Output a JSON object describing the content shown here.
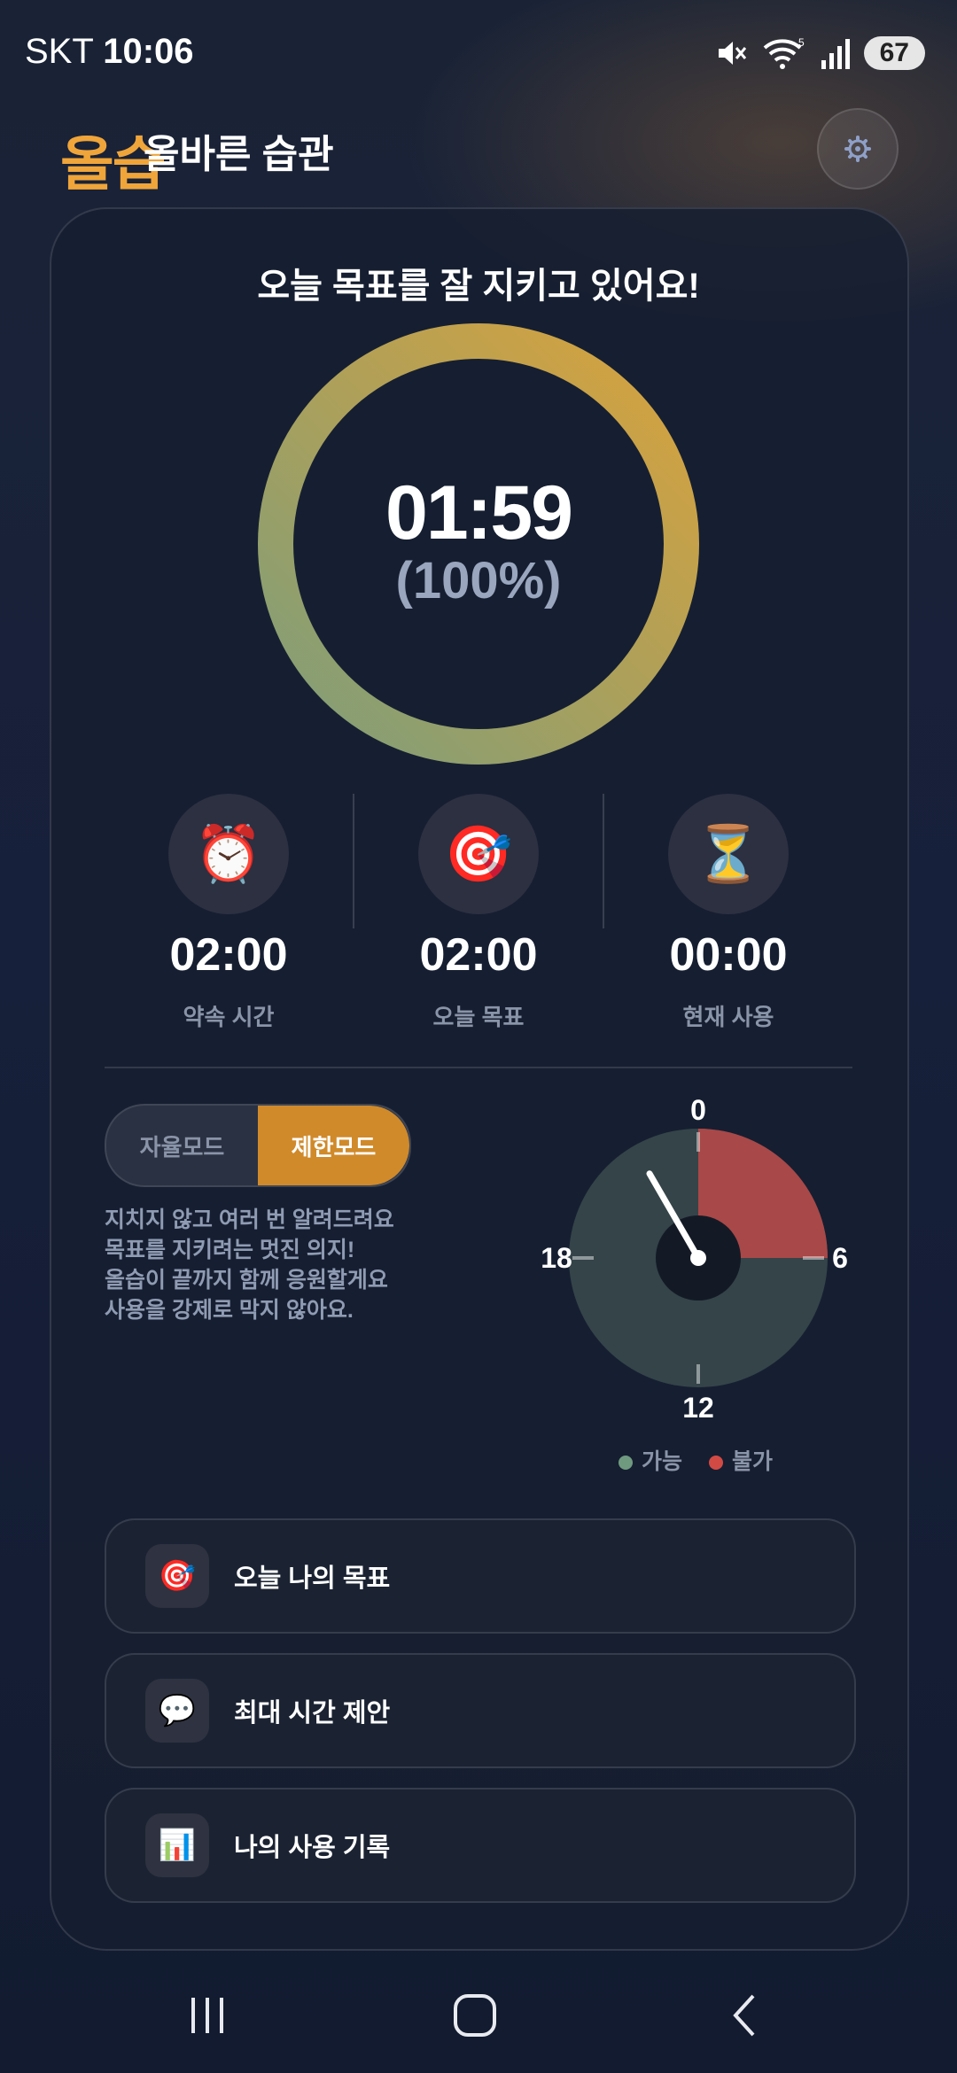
{
  "status_bar": {
    "carrier": "SKT",
    "time": "10:06",
    "battery": "67"
  },
  "header": {
    "logo": "올습",
    "title": "올바른 습관",
    "settings_icon": "gear-icon"
  },
  "main": {
    "headline": "오늘 목표를 잘 지키고 있어요!",
    "ring": {
      "time": "01:59",
      "percent_text": "(100%)",
      "progress": 1.0,
      "colors": [
        "#7e9e7a",
        "#d9a23c"
      ]
    },
    "stats": [
      {
        "icon": "alarm-clock-icon",
        "emoji": "⏰",
        "value": "02:00",
        "label": "약속 시간"
      },
      {
        "icon": "target-icon",
        "emoji": "🎯",
        "value": "02:00",
        "label": "오늘 목표"
      },
      {
        "icon": "hourglass-icon",
        "emoji": "⏳",
        "value": "00:00",
        "label": "현재 사용"
      }
    ],
    "mode": {
      "options": [
        "자율모드",
        "제한모드"
      ],
      "selected": "제한모드",
      "accent": "#d08a2a",
      "description": [
        "지치지 않고 여러 번 알려드려요",
        "목표를 지키려는 멋진 의지!",
        "올습이 끝까지 함께 응원할게요",
        "사용을 강제로 막지 않아요."
      ]
    },
    "clock": {
      "labels": {
        "top": "0",
        "right": "6",
        "bottom": "12",
        "left": "18"
      },
      "blocked_range_hours": [
        0,
        6
      ],
      "current_hour": 22,
      "allowed_color": "#344449",
      "blocked_color": "#a84848"
    },
    "legend": [
      {
        "label": "가능",
        "color": "#6f9a80"
      },
      {
        "label": "불가",
        "color": "#d24a44"
      }
    ],
    "menu": [
      {
        "icon": "target-icon",
        "emoji": "🎯",
        "label": "오늘 나의 목표"
      },
      {
        "icon": "speech-bubble-icon",
        "emoji": "💬",
        "label": "최대 시간 제안"
      },
      {
        "icon": "bar-chart-icon",
        "emoji": "📊",
        "label": "나의 사용 기록"
      }
    ]
  },
  "nav": {
    "recent": "recent-apps-icon",
    "home": "home-icon",
    "back": "back-icon"
  }
}
